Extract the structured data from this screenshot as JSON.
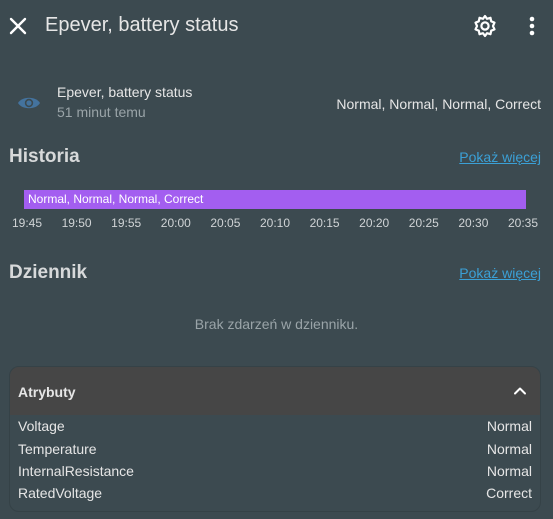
{
  "header": {
    "title": "Epever, battery status",
    "close_icon": "close-icon",
    "settings_icon": "gear-icon",
    "menu_icon": "more-vertical-icon"
  },
  "entity": {
    "icon": "eye-icon",
    "name": "Epever, battery status",
    "last_changed": "51 minut temu",
    "state": "Normal, Normal, Normal, Correct",
    "icon_color": "#44739e"
  },
  "history": {
    "title": "Historia",
    "more_link": "Pokaż więcej",
    "bar_label": "Normal, Normal, Normal, Correct",
    "bar_color": "#a35ef0",
    "ticks": [
      "19:45",
      "19:50",
      "19:55",
      "20:00",
      "20:05",
      "20:10",
      "20:15",
      "20:20",
      "20:25",
      "20:30",
      "20:35"
    ]
  },
  "logbook": {
    "title": "Dziennik",
    "more_link": "Pokaż więcej",
    "empty_text": "Brak zdarzeń w dzienniku."
  },
  "attributes": {
    "title": "Atrybuty",
    "rows": [
      {
        "key": "Voltage",
        "value": "Normal"
      },
      {
        "key": "Temperature",
        "value": "Normal"
      },
      {
        "key": "InternalResistance",
        "value": "Normal"
      },
      {
        "key": "RatedVoltage",
        "value": "Correct"
      }
    ]
  }
}
